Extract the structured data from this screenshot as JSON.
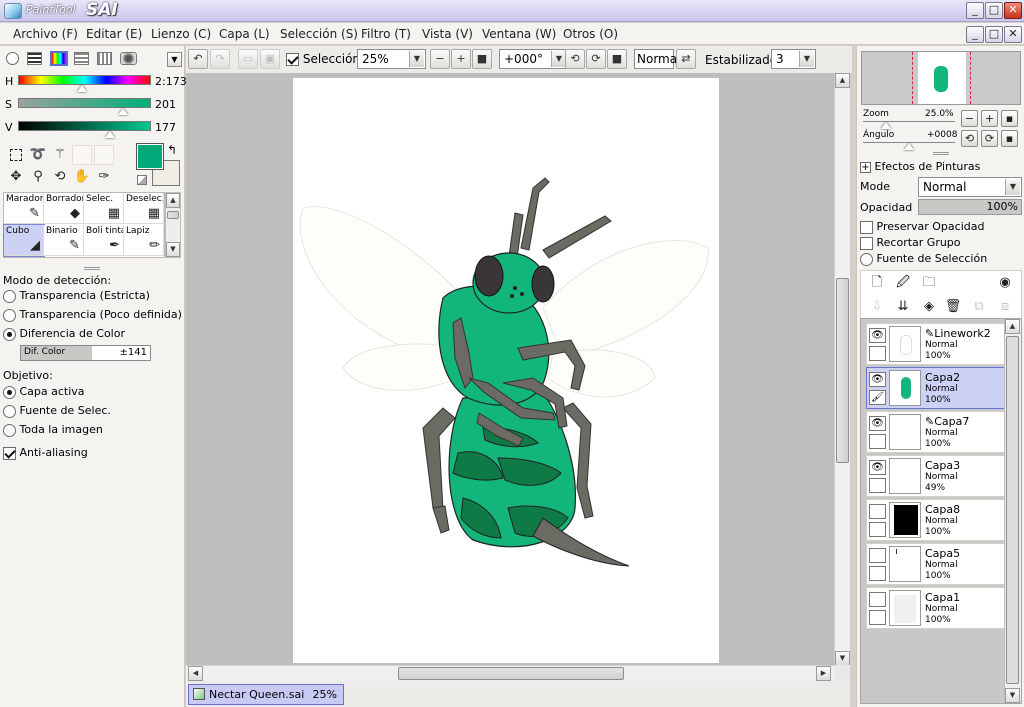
{
  "app": {
    "logo_small": "PaintTool",
    "logo_big": "SAI"
  },
  "window_buttons": [
    "_",
    "□",
    "✕"
  ],
  "menu": [
    {
      "label": "Archivo (F)"
    },
    {
      "label": "Editar (E)"
    },
    {
      "label": "Lienzo (C)"
    },
    {
      "label": "Capa (L)"
    },
    {
      "label": "Selección (S)"
    },
    {
      "label": "Filtro (T)"
    },
    {
      "label": "Vista (V)"
    },
    {
      "label": "Ventana (W)"
    },
    {
      "label": "Otros (O)"
    }
  ],
  "toolbar": {
    "selection_label": "Selección",
    "selection_checked": true,
    "zoom": "25%",
    "angle": "+000°",
    "blend": "Normal",
    "stabilizer_label": "Estabilizador",
    "stabilizer_value": "3"
  },
  "color": {
    "h_label": "H",
    "h_value": "2:173",
    "h_level": 0.48,
    "s_label": "S",
    "s_value": "201",
    "s_level": 0.79,
    "v_label": "V",
    "v_value": "177",
    "v_level": 0.69,
    "primary": "#00aa78",
    "secondary": "#f0ede6"
  },
  "brushes": [
    {
      "label": "Marador",
      "icon": "✎"
    },
    {
      "label": "Borrador",
      "icon": "◆"
    },
    {
      "label": "Selec.",
      "icon": "▦"
    },
    {
      "label": "Deselec.",
      "icon": "▦"
    },
    {
      "label": "Cubo",
      "icon": "◢"
    },
    {
      "label": "Binario",
      "icon": "✎"
    },
    {
      "label": "Boli tinta",
      "icon": "✒"
    },
    {
      "label": "Lapiz",
      "icon": "✏"
    }
  ],
  "detection": {
    "title": "Modo de detección:",
    "options": [
      {
        "label": "Transparencia (Estricta)",
        "checked": false
      },
      {
        "label": "Transparencia (Poco definida)",
        "checked": false
      },
      {
        "label": "Diferencia de Color",
        "checked": true
      }
    ],
    "dif_label": "Dif. Color",
    "dif_value": "±141",
    "dif_level": 0.55
  },
  "target": {
    "title": "Objetivo:",
    "options": [
      {
        "label": "Capa activa",
        "checked": true
      },
      {
        "label": "Fuente de Selec.",
        "checked": false
      },
      {
        "label": "Toda la imagen",
        "checked": false
      }
    ],
    "antialias_label": "Anti-aliasing",
    "antialias_checked": true
  },
  "navigator": {
    "zoom_label": "Zoom",
    "zoom_value": "25.0%",
    "zoom_level": 0.25,
    "angle_label": "Ángulo",
    "angle_value": "+0008",
    "angle_level": 0.5
  },
  "layer_props": {
    "effects_label": "Efectos de Pinturas",
    "mode_label": "Mode",
    "mode_value": "Normal",
    "opacity_label": "Opacidad",
    "opacity_value": "100%",
    "preserve_label": "Preservar Opacidad",
    "clip_label": "Recortar Grupo",
    "source_label": "Fuente de Selección"
  },
  "layers": [
    {
      "name": "Linework2",
      "mode": "Normal",
      "opacity": "100%",
      "visible": true,
      "selected": false,
      "pen": true,
      "thumb": "sketch"
    },
    {
      "name": "Capa2",
      "mode": "Normal",
      "opacity": "100%",
      "visible": true,
      "selected": true,
      "pen": false,
      "thumb": "bug"
    },
    {
      "name": "Capa7",
      "mode": "Normal",
      "opacity": "100%",
      "visible": true,
      "selected": false,
      "pen": true,
      "thumb": "white"
    },
    {
      "name": "Capa3",
      "mode": "Normal",
      "opacity": "49%",
      "visible": true,
      "selected": false,
      "pen": false,
      "thumb": "white"
    },
    {
      "name": "Capa8",
      "mode": "Normal",
      "opacity": "100%",
      "visible": false,
      "selected": false,
      "pen": false,
      "thumb": "black"
    },
    {
      "name": "Capa5",
      "mode": "Normal",
      "opacity": "100%",
      "visible": false,
      "selected": false,
      "pen": false,
      "thumb": "mark"
    },
    {
      "name": "Capa1",
      "mode": "Normal",
      "opacity": "100%",
      "visible": false,
      "selected": false,
      "pen": false,
      "thumb": "grey"
    }
  ],
  "document": {
    "filename": "Nectar Queen.sai",
    "zoom": "25%"
  },
  "icons": {
    "eye": "eye-icon",
    "pen": "pen-lock-icon",
    "new_layer": "new-layer-icon",
    "new_linework": "new-linework-icon",
    "new_folder": "new-folder-icon",
    "mask": "mask-icon",
    "delete": "trash-icon"
  },
  "colors": {
    "accent": "#6c72d4",
    "selection": "#cdd2f4",
    "bug_green": "#12b67a"
  }
}
